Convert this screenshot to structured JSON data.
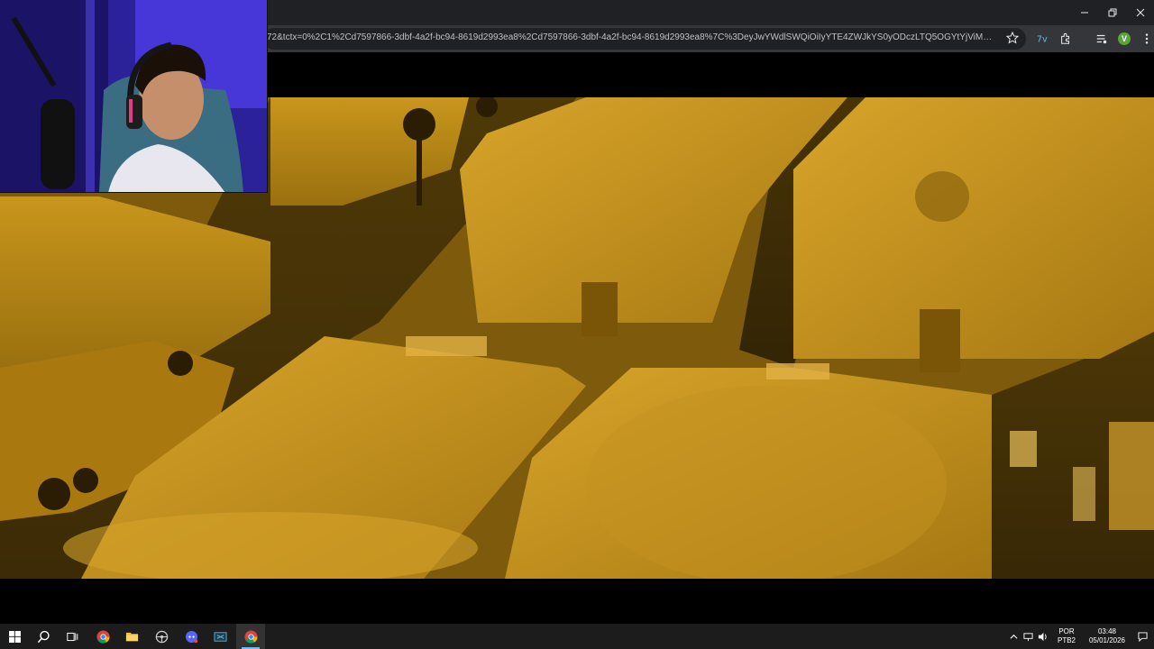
{
  "browser": {
    "url": "72&tctx=0%2C1%2Cd7597866-3dbf-4a2f-bc94-8619d2993ea8%2Cd7597866-3dbf-4a2f-bc94-8619d2993ea8%7C%3DeyJwYWdlSWQiOiIyYTE4ZWJkYS0yODczLTQ5OGYtYjViMy1mNzFhMWIwYTNj...",
    "profile_initial": "V"
  },
  "taskbar": {
    "lang_line1": "POR",
    "lang_line2": "PTB2",
    "time": "03:48",
    "date": "05/01/2026"
  },
  "colors": {
    "accent": "#76b9ed",
    "video_tint": "#b8860b"
  }
}
